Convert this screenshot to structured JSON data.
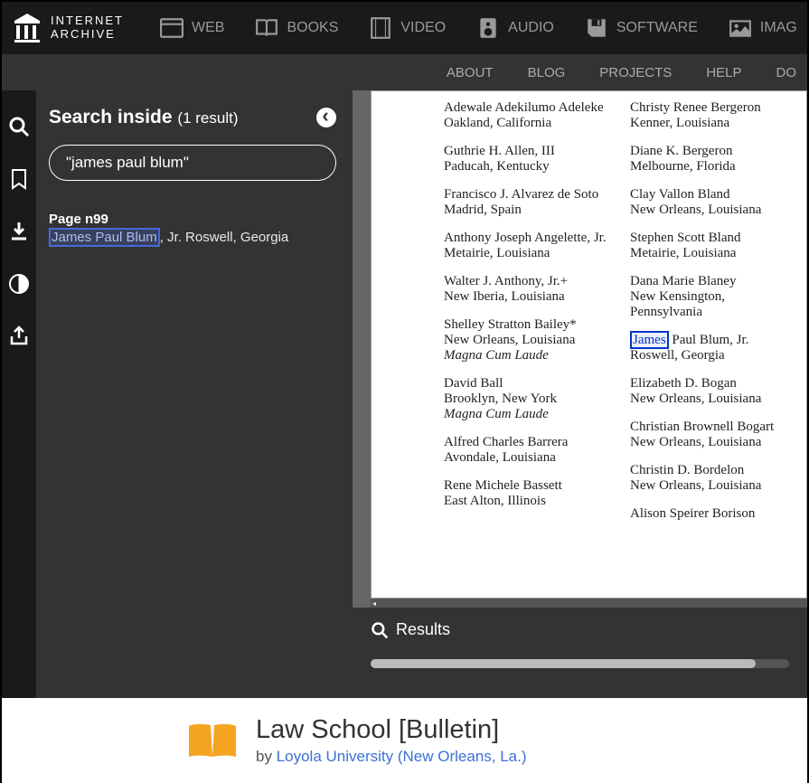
{
  "topnav": {
    "logo_line1": "INTERNET",
    "logo_line2": "ARCHIVE",
    "items": [
      {
        "key": "web",
        "label": "WEB"
      },
      {
        "key": "books",
        "label": "BOOKS"
      },
      {
        "key": "video",
        "label": "VIDEO"
      },
      {
        "key": "audio",
        "label": "AUDIO"
      },
      {
        "key": "software",
        "label": "SOFTWARE"
      },
      {
        "key": "images",
        "label": "IMAG"
      }
    ]
  },
  "secnav": {
    "items": [
      "ABOUT",
      "BLOG",
      "PROJECTS",
      "HELP",
      "DO"
    ]
  },
  "panel": {
    "title": "Search inside",
    "count": "(1 result)",
    "query": "\"james paul blum\"",
    "result": {
      "page": "Page n99",
      "highlight": "James Paul Blum",
      "rest": ", Jr. Roswell, Georgia"
    }
  },
  "page": {
    "col1": [
      {
        "name": "Adewale Adekilumo Adeleke",
        "loc": "Oakland, California"
      },
      {
        "name": "Guthrie H. Allen, III",
        "loc": "Paducah, Kentucky"
      },
      {
        "name": "Francisco J. Alvarez de Soto",
        "loc": "Madrid, Spain"
      },
      {
        "name": "Anthony Joseph Angelette, Jr.",
        "loc": "Metairie, Louisiana"
      },
      {
        "name": "Walter J. Anthony, Jr.+",
        "loc": "New Iberia, Louisiana"
      },
      {
        "name": "Shelley Stratton Bailey*",
        "loc": "New Orleans, Louisiana",
        "honor": "Magna Cum Laude"
      },
      {
        "name": "David Ball",
        "loc": "Brooklyn, New York",
        "honor": "Magna Cum Laude"
      },
      {
        "name": "Alfred Charles Barrera",
        "loc": "Avondale, Louisiana"
      },
      {
        "name": "Rene Michele Bassett",
        "loc": "East Alton, Illinois"
      }
    ],
    "col2": [
      {
        "name": "Christy Renee Bergeron",
        "loc": "Kenner, Louisiana"
      },
      {
        "name": "Diane K. Bergeron",
        "loc": "Melbourne, Florida"
      },
      {
        "name": "Clay Vallon Bland",
        "loc": "New Orleans, Louisiana"
      },
      {
        "name": "Stephen Scott Bland",
        "loc": "Metairie, Louisiana"
      },
      {
        "name": "Dana Marie Blaney",
        "loc": "New Kensington, Pennsylvania"
      },
      {
        "name_hl_pre": "James",
        "name_rest": " Paul Blum, Jr.",
        "loc": "Roswell, Georgia"
      },
      {
        "name": "Elizabeth D. Bogan",
        "loc": "New Orleans, Louisiana"
      },
      {
        "name": "Christian Brownell Bogart",
        "loc": "New Orleans, Louisiana"
      },
      {
        "name": "Christin D. Bordelon",
        "loc": "New Orleans, Louisiana"
      },
      {
        "name": "Alison Speirer Borison",
        "loc": ""
      }
    ]
  },
  "resultsbar": {
    "label": "Results"
  },
  "footer": {
    "title": "Law School [Bulletin]",
    "by_prefix": "by ",
    "by_link": "Loyola University (New Orleans, La.)"
  }
}
